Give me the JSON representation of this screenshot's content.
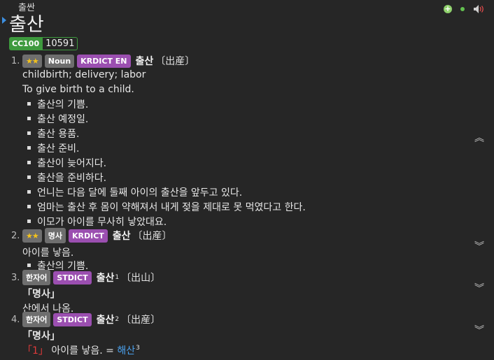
{
  "reading": "출싼",
  "headword": "출산",
  "frequency": {
    "label": "CC100",
    "count": "10591"
  },
  "entries": [
    {
      "index": "1.",
      "stars": "★★",
      "badges": [
        "Noun",
        "KRDICT EN"
      ],
      "word": "출산",
      "sup": "",
      "hanja": "〔出産〕",
      "definitions": [
        "childbirth; delivery; labor",
        "To give birth to a child."
      ],
      "examples": [
        "출산의 기쁨.",
        "출산 예정일.",
        "출산 용품.",
        "출산 준비.",
        "출산이 늦어지다.",
        "출산을 준비하다.",
        "언니는 다음 달에 둘째 아이의 출산을 앞두고 있다.",
        "엄마는 출산 후 몸이 약해져서 내게 젖을 제대로 못 먹였다고 한다.",
        "이모가 아이를 무사히 낳았대요."
      ]
    },
    {
      "index": "2.",
      "stars": "★★",
      "badges": [
        "명사",
        "KRDICT"
      ],
      "word": "출산",
      "sup": "",
      "hanja": "〔出産〕",
      "definitions": [
        "아이를 낳음."
      ],
      "examples": [
        "출산의 기쁨."
      ]
    },
    {
      "index": "3.",
      "stars": "",
      "badges": [
        "한자어",
        "STDICT"
      ],
      "word": "출산",
      "sup": "1",
      "hanja": "〔出山〕",
      "pos": "「명사」",
      "definitions": [
        "산에서 나옴."
      ],
      "examples": []
    },
    {
      "index": "4.",
      "stars": "",
      "badges": [
        "한자어",
        "STDICT"
      ],
      "word": "출산",
      "sup": "2",
      "hanja": "〔出産〕",
      "pos": "「명사」",
      "sense_num": "「1」",
      "definition": "아이를 낳음. =",
      "synonym": "해산",
      "synonym_sup": "3",
      "examples": []
    }
  ],
  "icons": {
    "add": "plus-circle-icon",
    "status": "green-dot-icon",
    "audio": "speaker-icon",
    "collapse": "chevron-up-double-icon",
    "expand": "chevron-down-double-icon"
  }
}
